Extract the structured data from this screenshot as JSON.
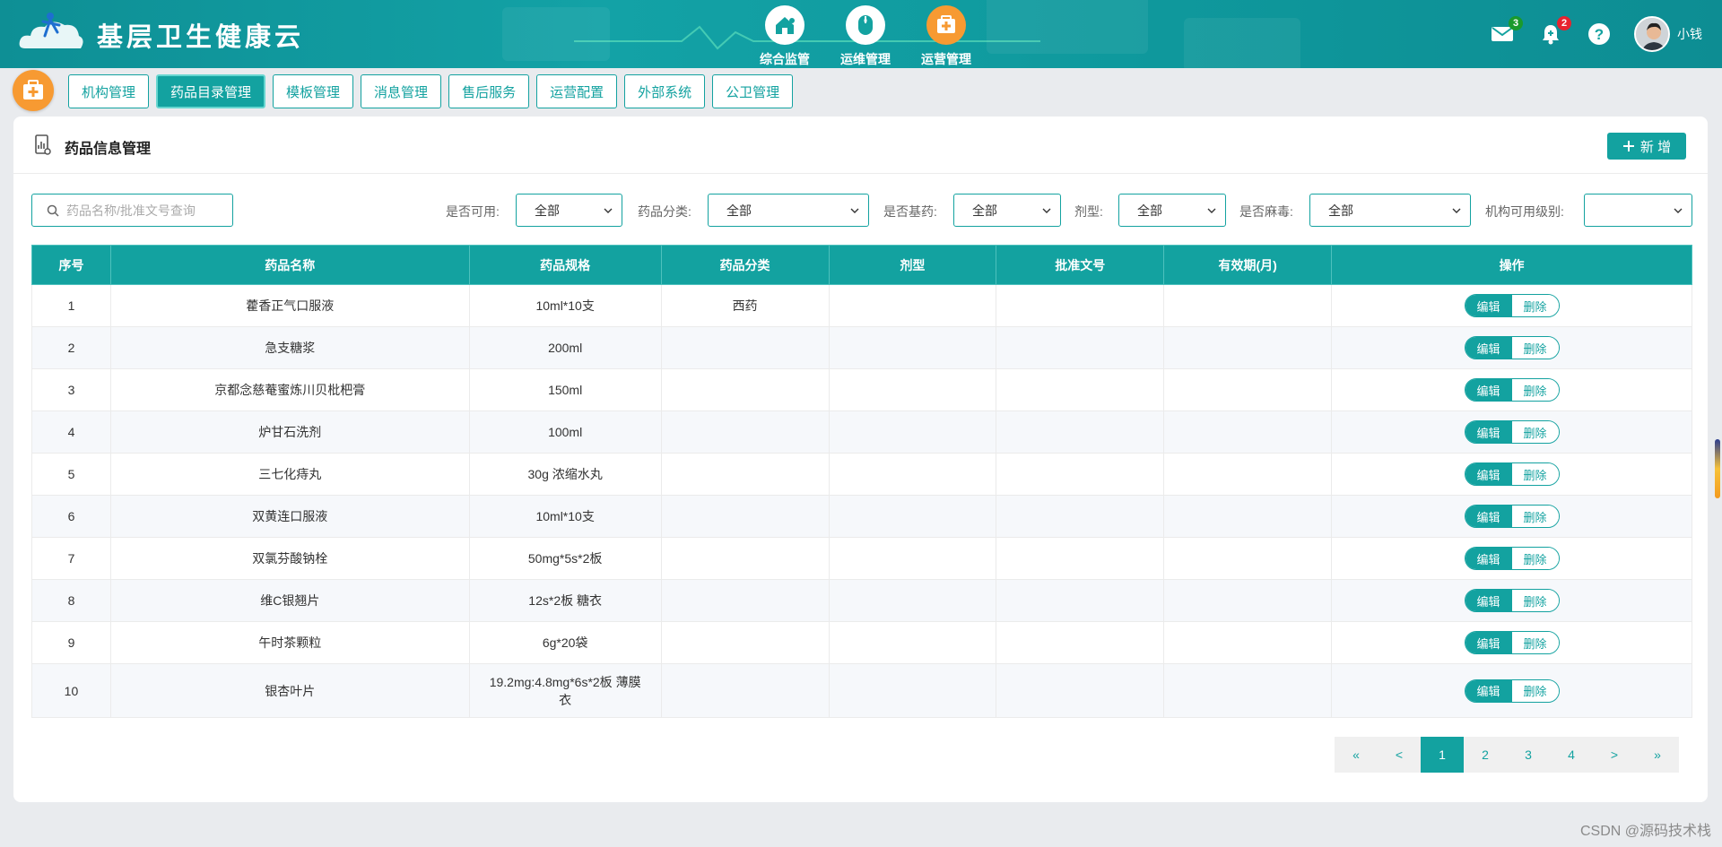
{
  "header": {
    "title": "基层卫生健康云",
    "nav": [
      {
        "label": "综合监管",
        "icon": "house-icon",
        "active": false
      },
      {
        "label": "运维管理",
        "icon": "mouse-icon",
        "active": false
      },
      {
        "label": "运营管理",
        "icon": "medical-kit-icon",
        "active": true
      }
    ],
    "mail_badge": "3",
    "bell_badge": "2",
    "username": "小钱"
  },
  "subnav": {
    "tabs": [
      "机构管理",
      "药品目录管理",
      "模板管理",
      "消息管理",
      "售后服务",
      "运营配置",
      "外部系统",
      "公卫管理"
    ],
    "active_index": 1
  },
  "panel": {
    "title": "药品信息管理",
    "add_label": "新 增"
  },
  "filters": {
    "search_placeholder": "药品名称/批准文号查询",
    "available_label": "是否可用:",
    "available_value": "全部",
    "category_label": "药品分类:",
    "category_value": "全部",
    "essential_label": "是否基药:",
    "essential_value": "全部",
    "form_label": "剂型:",
    "form_value": "全部",
    "narcotic_label": "是否麻毒:",
    "narcotic_value": "全部",
    "level_label": "机构可用级别:",
    "level_value": ""
  },
  "table": {
    "headers": [
      "序号",
      "药品名称",
      "药品规格",
      "药品分类",
      "剂型",
      "批准文号",
      "有效期(月)",
      "操作"
    ],
    "edit_label": "编辑",
    "delete_label": "删除",
    "rows": [
      {
        "no": "1",
        "name": "藿香正气口服液",
        "spec": "10ml*10支",
        "category": "西药",
        "form": "",
        "approval": "",
        "validity": ""
      },
      {
        "no": "2",
        "name": "急支糖浆",
        "spec": "200ml",
        "category": "",
        "form": "",
        "approval": "",
        "validity": ""
      },
      {
        "no": "3",
        "name": "京都念慈菴蜜炼川贝枇杷膏",
        "spec": "150ml",
        "category": "",
        "form": "",
        "approval": "",
        "validity": ""
      },
      {
        "no": "4",
        "name": "炉甘石洗剂",
        "spec": "100ml",
        "category": "",
        "form": "",
        "approval": "",
        "validity": ""
      },
      {
        "no": "5",
        "name": "三七化痔丸",
        "spec": "30g 浓缩水丸",
        "category": "",
        "form": "",
        "approval": "",
        "validity": ""
      },
      {
        "no": "6",
        "name": "双黄连口服液",
        "spec": "10ml*10支",
        "category": "",
        "form": "",
        "approval": "",
        "validity": ""
      },
      {
        "no": "7",
        "name": "双氯芬酸钠栓",
        "spec": "50mg*5s*2板",
        "category": "",
        "form": "",
        "approval": "",
        "validity": ""
      },
      {
        "no": "8",
        "name": "维C银翘片",
        "spec": "12s*2板 糖衣",
        "category": "",
        "form": "",
        "approval": "",
        "validity": ""
      },
      {
        "no": "9",
        "name": "午时茶颗粒",
        "spec": "6g*20袋",
        "category": "",
        "form": "",
        "approval": "",
        "validity": ""
      },
      {
        "no": "10",
        "name": "银杏叶片",
        "spec": "19.2mg:4.8mg*6s*2板 薄膜衣",
        "category": "",
        "form": "",
        "approval": "",
        "validity": ""
      }
    ]
  },
  "pagination": {
    "first": "«",
    "prev": "<",
    "pages": [
      "1",
      "2",
      "3",
      "4"
    ],
    "current": "1",
    "next": ">",
    "last": "»"
  },
  "watermark": "CSDN @源码技术栈",
  "colors": {
    "primary": "#13a2a0",
    "accent": "#f79a32",
    "badge_green": "#1a9a2c",
    "badge_red": "#e7232f"
  }
}
